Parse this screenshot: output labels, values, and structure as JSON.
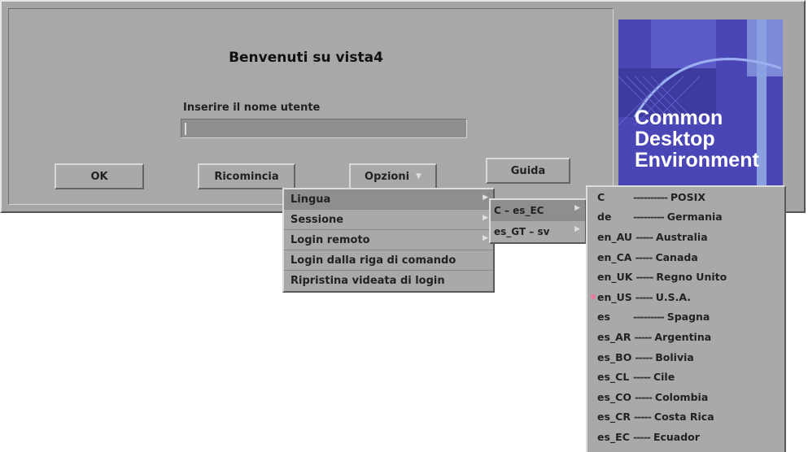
{
  "login": {
    "welcome": "Benvenuti su vista4",
    "username_label": "Inserire il nome utente",
    "username_value": "",
    "buttons": {
      "ok": "OK",
      "restart": "Ricomincia",
      "options": "Opzioni",
      "help": "Guida"
    }
  },
  "logo": {
    "lines": [
      "Common",
      "Desktop",
      "Environment"
    ],
    "background_color": "#4a46b5"
  },
  "options_menu": {
    "items": [
      {
        "label": "Lingua",
        "has_submenu": true,
        "highlighted": true
      },
      {
        "label": "Sessione",
        "has_submenu": true
      },
      {
        "label": "Login remoto",
        "has_submenu": true
      },
      {
        "label": "Login dalla riga di comando",
        "has_submenu": false
      },
      {
        "label": "Ripristina videata di login",
        "has_submenu": false
      }
    ]
  },
  "language_groups": {
    "items": [
      {
        "label": "C – es_EC",
        "has_submenu": true,
        "highlighted": true
      },
      {
        "label": "es_GT – sv",
        "has_submenu": true
      }
    ]
  },
  "languages": {
    "selected": "en_US",
    "items": [
      {
        "code": "C",
        "dashes": "----------",
        "name": "POSIX"
      },
      {
        "code": "de",
        "dashes": "---------",
        "name": "Germania"
      },
      {
        "code": "en_AU",
        "dashes": "-----",
        "name": "Australia"
      },
      {
        "code": "en_CA",
        "dashes": "-----",
        "name": "Canada"
      },
      {
        "code": "en_UK",
        "dashes": "-----",
        "name": "Regno Unito"
      },
      {
        "code": "en_US",
        "dashes": "-----",
        "name": "U.S.A."
      },
      {
        "code": "es",
        "dashes": "---------",
        "name": "Spagna"
      },
      {
        "code": "es_AR",
        "dashes": "-----",
        "name": "Argentina"
      },
      {
        "code": "es_BO",
        "dashes": "-----",
        "name": "Bolivia"
      },
      {
        "code": "es_CL",
        "dashes": "-----",
        "name": "Cile"
      },
      {
        "code": "es_CO",
        "dashes": "-----",
        "name": "Colombia"
      },
      {
        "code": "es_CR",
        "dashes": "-----",
        "name": "Costa Rica"
      },
      {
        "code": "es_EC",
        "dashes": "-----",
        "name": "Ecuador"
      }
    ]
  },
  "colors": {
    "window_bg": "#a5a5a5",
    "menu_highlight": "#8e8e8e",
    "radio_selected": "#e87a9a"
  }
}
